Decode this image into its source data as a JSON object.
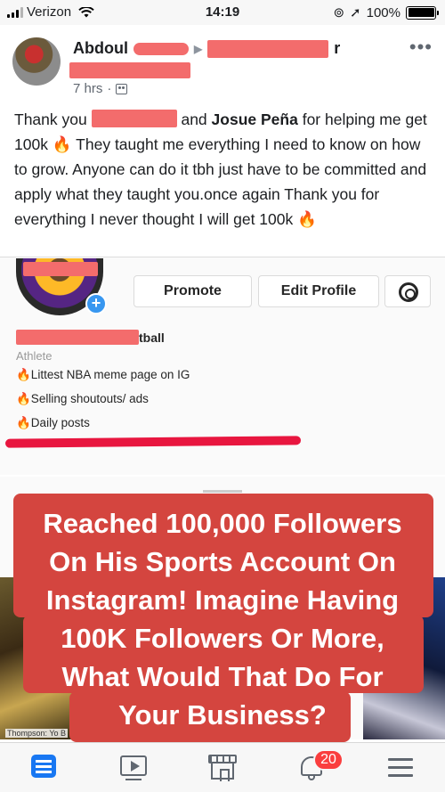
{
  "status_bar": {
    "carrier": "Verizon",
    "time": "14:19",
    "battery": "100%",
    "battery_level": 1.0
  },
  "post": {
    "author_first": "Abdoul",
    "author_tail": "r",
    "time_ago": "7 hrs",
    "dot": "·",
    "text": {
      "p1": "Thank you",
      "p2": "and",
      "tagged": "Josue Peña",
      "p3": "for helping me get 100k",
      "fire": "🔥",
      "p4": "They taught me everything I need to know on how to grow. Anyone can do it tbh just have to be committed and apply what they taught you.once again Thank you for everything I never thought I will get 100k"
    }
  },
  "instagram": {
    "promote_label": "Promote",
    "edit_profile_label": "Edit Profile",
    "plus": "+",
    "name_tail": "tball",
    "category": "Athlete",
    "bio": [
      "🔥Littest NBA meme page on IG",
      "🔥Selling shoutouts/ ads",
      "🔥Daily posts"
    ],
    "photo_caption": "Thompson: Yo B"
  },
  "overlay": {
    "lines": [
      "Reached 100,000 Followers",
      "On His Sports Account On",
      "Instagram! Imagine Having",
      "100K Followers Or More,",
      "What Would That Do For",
      "Your Business?"
    ]
  },
  "tab_bar": {
    "notifications_count": "20",
    "icons": [
      "news-feed-icon",
      "video-icon",
      "marketplace-icon",
      "notifications-bell-icon",
      "menu-icon"
    ]
  },
  "colors": {
    "facebook_blue": "#1877f2",
    "overlay_red": "#d4453f",
    "redaction": "#f36c6c",
    "badge_red": "#fa3e3e"
  }
}
